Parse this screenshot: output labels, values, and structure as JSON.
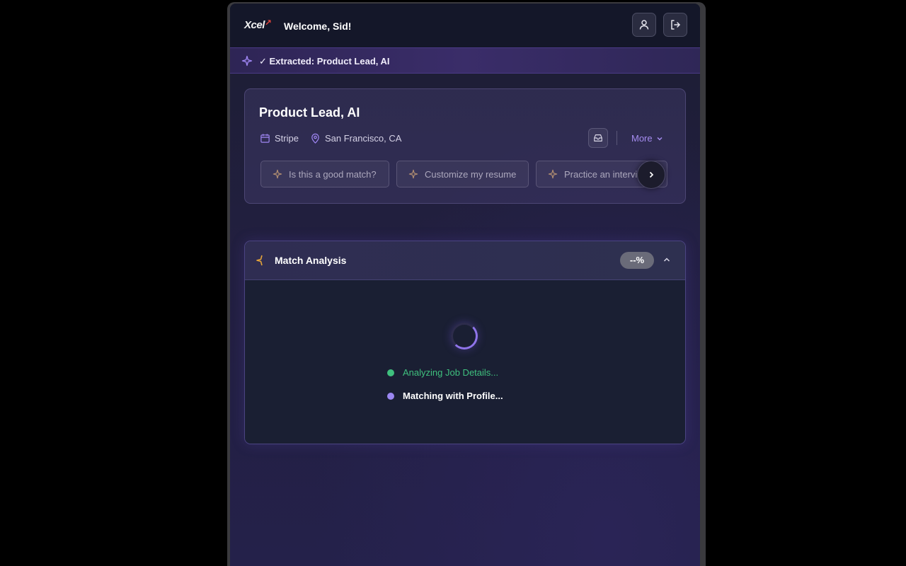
{
  "header": {
    "logo_text": "Xcel",
    "welcome": "Welcome, Sid!",
    "profile_icon": "user-icon",
    "logout_icon": "logout-icon"
  },
  "banner": {
    "icon": "sparkle-icon",
    "text": "✓ Extracted: Product Lead, AI"
  },
  "job": {
    "title": "Product Lead, AI",
    "company": "Stripe",
    "location": "San Francisco, CA",
    "more_label": "More",
    "suggestions": [
      {
        "label": "Is this a good match?"
      },
      {
        "label": "Customize my resume"
      },
      {
        "label": "Practice an interview"
      }
    ]
  },
  "match_analysis": {
    "title": "Match Analysis",
    "score": "--%",
    "steps": [
      {
        "label": "Analyzing Job Details...",
        "status": "done"
      },
      {
        "label": "Matching with Profile...",
        "status": "active"
      }
    ]
  },
  "colors": {
    "accent": "#8f74ea",
    "success": "#3fc07e",
    "brand_mark": "#e0453c"
  }
}
